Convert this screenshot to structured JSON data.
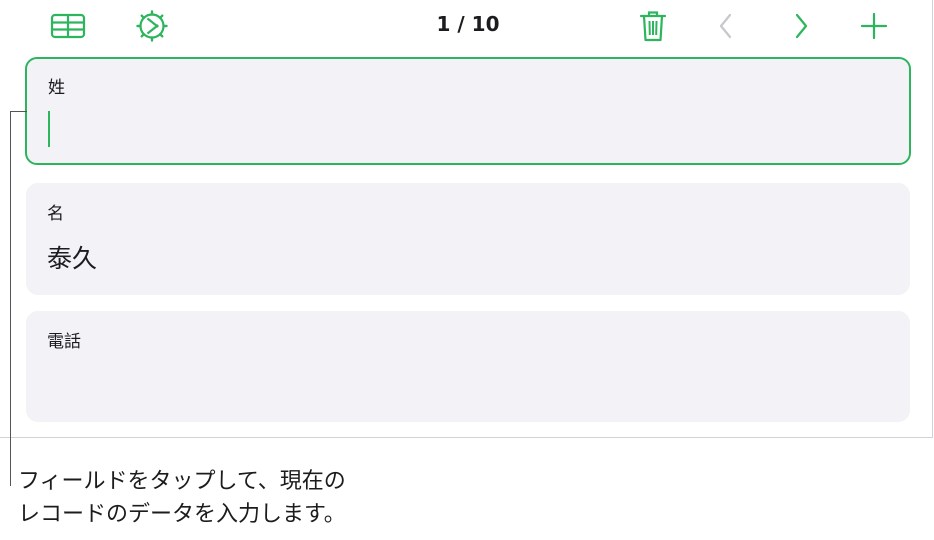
{
  "toolbar": {
    "counter": "1 / 10",
    "icons": [
      "table-grid-icon",
      "record-settings-icon",
      "trash-icon",
      "chevron-left-icon",
      "chevron-right-icon",
      "plus-icon"
    ],
    "accent": "#2db55d",
    "disabled": "#c7c7cc"
  },
  "fields": [
    {
      "label": "姓",
      "value": "",
      "state": "focused"
    },
    {
      "label": "名",
      "value": "泰久",
      "state": "normal"
    },
    {
      "label": "電話",
      "value": "",
      "state": "normal"
    }
  ],
  "callout": {
    "line1": "フィールドをタップして、現在の",
    "line2": "レコードのデータを入力します。"
  }
}
